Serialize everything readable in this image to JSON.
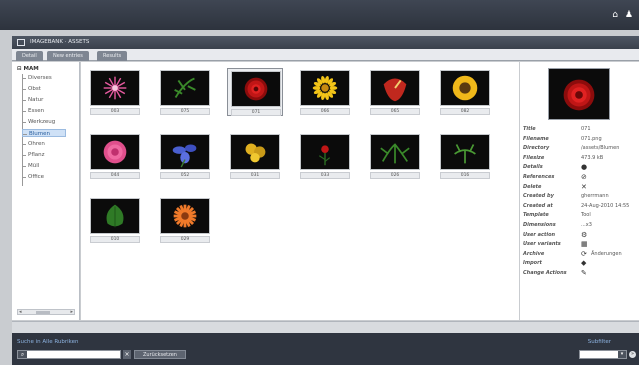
{
  "window": {
    "title": "IMAGEBANK · ASSETS"
  },
  "tabs": [
    "Detail",
    "New entries",
    "Results"
  ],
  "tree": {
    "root": "MAM",
    "items": [
      "Diverses",
      "Obst",
      "Natur",
      "Essen",
      "Werkzeug",
      "Blumen",
      "Ohren",
      "Pflanz",
      "Müll",
      "Office"
    ],
    "selected_index": 5
  },
  "thumbnails": [
    {
      "caption": "003",
      "flower": "pink-star"
    },
    {
      "caption": "075",
      "flower": "green-sprig"
    },
    {
      "caption": "071",
      "flower": "red-rose",
      "selected": true
    },
    {
      "caption": "066",
      "flower": "yellow-daisy"
    },
    {
      "caption": "065",
      "flower": "red-anthurium"
    },
    {
      "caption": "082",
      "flower": "yellow-sunflower"
    },
    {
      "caption": "044",
      "flower": "pink-peony"
    },
    {
      "caption": "052",
      "flower": "blue-iris"
    },
    {
      "caption": "031",
      "flower": "yellow-cluster"
    },
    {
      "caption": "033",
      "flower": "red-small"
    },
    {
      "caption": "026",
      "flower": "green-leaves"
    },
    {
      "caption": "016",
      "flower": "green-sprig2"
    },
    {
      "caption": "010",
      "flower": "green-leaf"
    },
    {
      "caption": "029",
      "flower": "orange-gerbera"
    }
  ],
  "details": {
    "rows": [
      {
        "key": "Title",
        "value": "071"
      },
      {
        "key": "Filename",
        "value": "071.png"
      },
      {
        "key": "Directory",
        "value": "/assets/Blumen"
      },
      {
        "key": "Filesize",
        "value": "473.9 kB"
      },
      {
        "key": "Details",
        "icon": "info-icon"
      },
      {
        "key": "References",
        "icon": "link-icon"
      },
      {
        "key": "Delete",
        "icon": "delete-icon"
      },
      {
        "key": "Created by",
        "value": "gherrmann"
      },
      {
        "key": "Created at",
        "value": "24-Aug-2010 14:55"
      },
      {
        "key": "Template",
        "value": "Tool"
      },
      {
        "key": "Dimensions",
        "value": "...x3"
      },
      {
        "key": "User action",
        "icon": "action-icon"
      },
      {
        "key": "User variants",
        "icon": "variants-icon"
      },
      {
        "key": "Archive",
        "value": "Änderungen",
        "icon": "archive-icon"
      },
      {
        "key": "Import",
        "icon": "import-icon"
      },
      {
        "key": "Change Actions",
        "icon": "pencil-icon"
      }
    ]
  },
  "search": {
    "label": "Suche in Alle Rubriken",
    "value": "",
    "clear_label": "×",
    "reset_label": "Zurücksetzen"
  },
  "filter": {
    "label": "Subfilter",
    "value": ""
  },
  "colors": {
    "accent": "#8db3e0",
    "chrome": "#2f3540"
  }
}
